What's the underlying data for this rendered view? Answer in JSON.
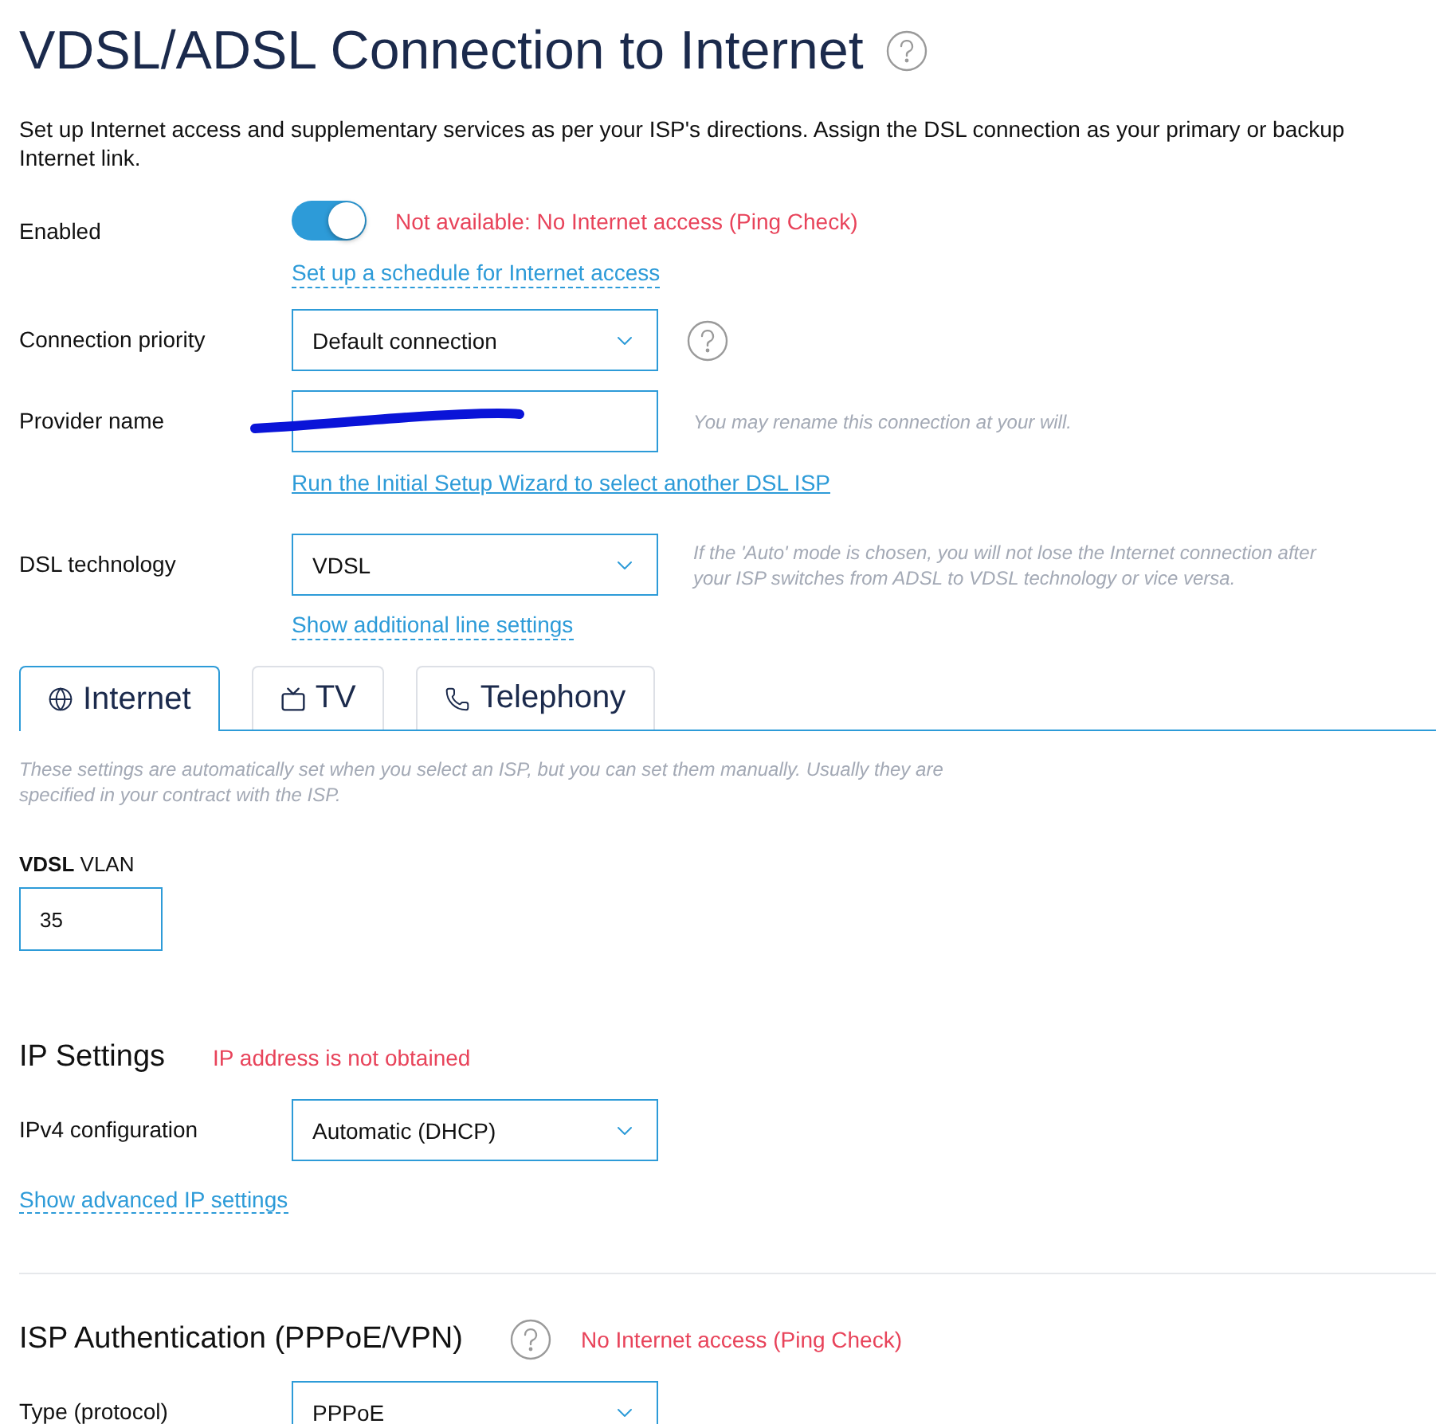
{
  "title": "VDSL/ADSL Connection to Internet",
  "title_help": true,
  "description": "Set up Internet access and supplementary services as per your ISP's directions. Assign the DSL connection as your primary or backup Internet link.",
  "form_rows": [
    {
      "kind": "toggle",
      "label": "Enabled",
      "on": true,
      "status": "Not available: No Internet access (Ping Check)",
      "link": "Set up a schedule for Internet access",
      "dashed": true
    },
    {
      "kind": "select",
      "label": "Connection priority",
      "value": "Default connection",
      "help": true
    },
    {
      "kind": "text",
      "label": "Provider name",
      "redacted": true,
      "hint": "You may rename this connection at your will.",
      "link": "Run the Initial Setup Wizard to select another DSL ISP",
      "dashed": false
    },
    {
      "kind": "select",
      "label": "DSL technology",
      "value": "VDSL",
      "hint": "If the 'Auto' mode is chosen, you will not lose the Internet connection after your ISP switches from ADSL to VDSL technology or vice versa.",
      "link": "Show additional line settings",
      "dashed": true
    }
  ],
  "tabs": [
    {
      "kind": "internet",
      "label": "Internet",
      "selected": true
    },
    {
      "kind": "tv",
      "label": "TV",
      "selected": false
    },
    {
      "kind": "telephony",
      "label": "Telephony",
      "selected": false
    }
  ],
  "tab_hint": "These settings are automatically set when you select an ISP, but you can set them manually. Usually they are specified in your contract with the ISP.",
  "vlan": {
    "label": "**VDSL** VLAN",
    "value": "35"
  },
  "ip_settings": {
    "title": "IP Settings",
    "status": "IP address is not obtained",
    "rows": [
      {
        "kind": "select",
        "label": "IPv4 configuration",
        "value": "Automatic (DHCP)"
      }
    ],
    "link": "Show advanced IP settings"
  },
  "isp_auth": {
    "title": "ISP Authentication (PPPoE/VPN)",
    "help": true,
    "status": "No Internet access (Ping Check)",
    "rows": [
      {
        "kind": "select",
        "label": "Type (protocol)",
        "value": "PPPoE"
      }
    ]
  }
}
